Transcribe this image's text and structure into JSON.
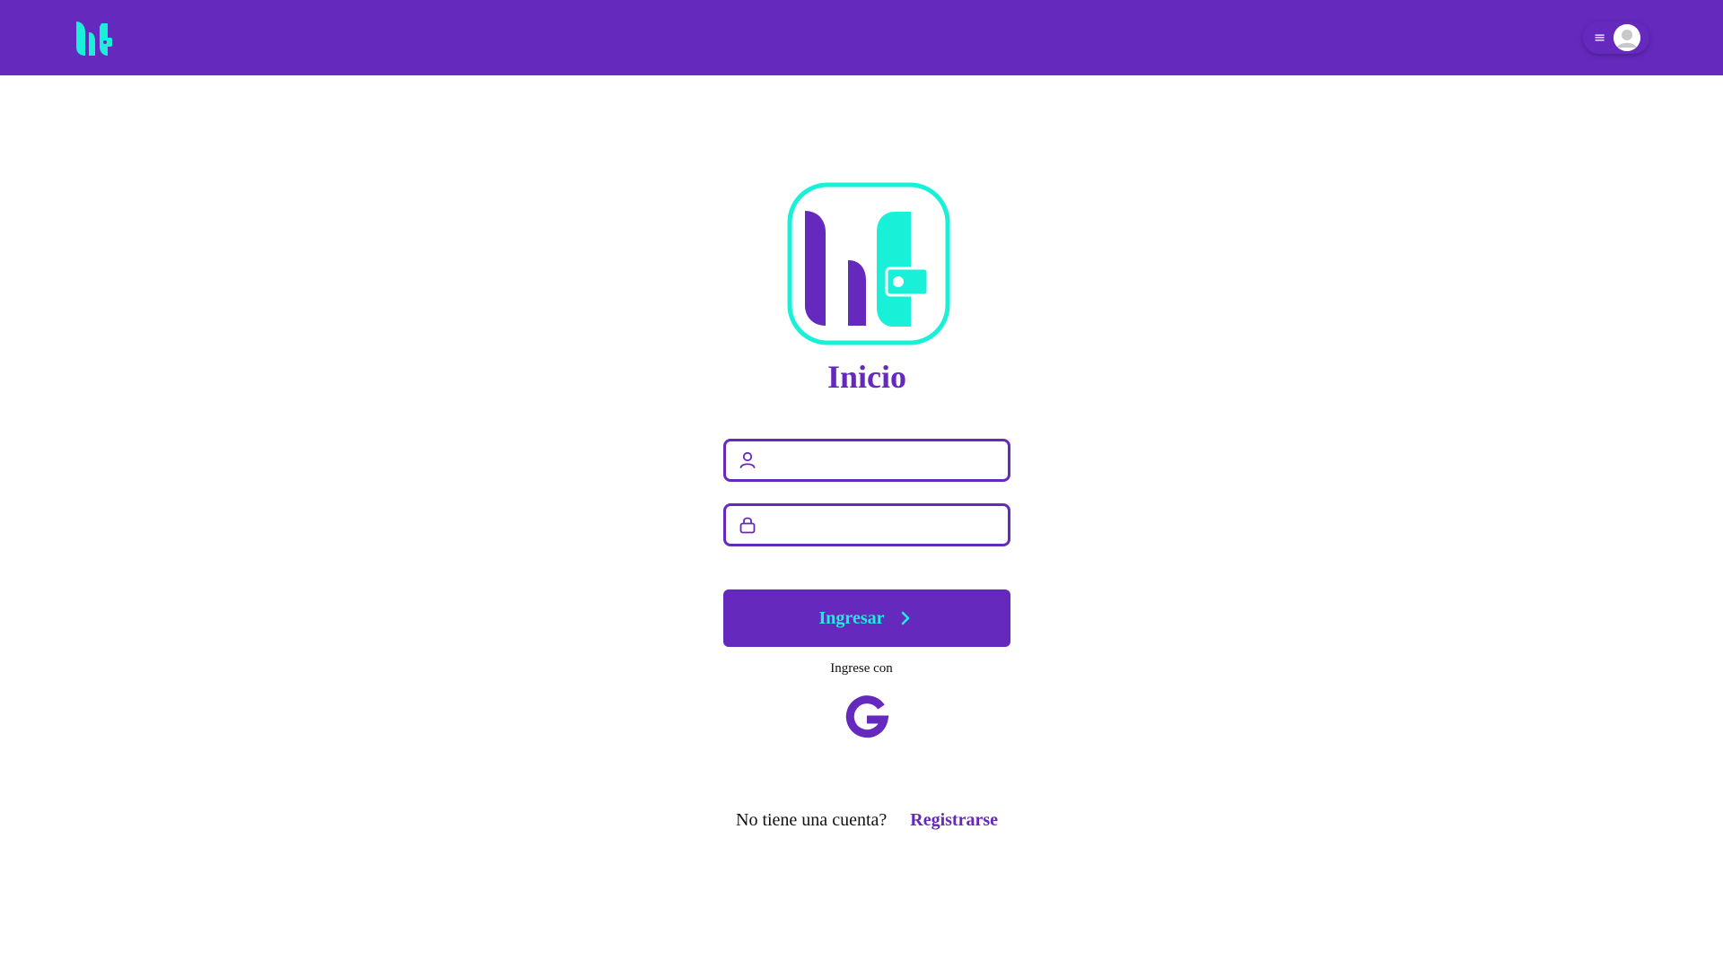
{
  "colors": {
    "brand_purple": "#6529be",
    "brand_teal": "#19f0d8",
    "background": "#ffffff"
  },
  "header": {
    "logo_icon": "wallet-logo-icon",
    "menu_icon": "hamburger-icon",
    "avatar_icon": "user-avatar-icon",
    "menu_glyph": "≡"
  },
  "main": {
    "title": "Inicio",
    "username_field": {
      "value": "",
      "placeholder": "",
      "icon": "user-icon"
    },
    "password_field": {
      "value": "",
      "placeholder": "",
      "icon": "lock-icon"
    },
    "login_button": {
      "label": "Ingresar",
      "icon": "chevron-right-icon"
    },
    "alt_login_text": "Ingrese con",
    "google_button": {
      "icon": "google-icon"
    },
    "signup_prompt": "No tiene una cuenta?",
    "signup_link": "Registrarse"
  }
}
